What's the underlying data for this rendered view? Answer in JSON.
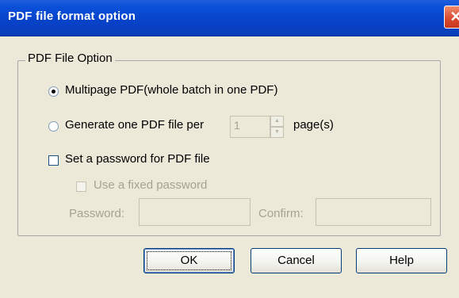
{
  "window": {
    "title": "PDF file format option",
    "close_glyph": "✕"
  },
  "group": {
    "legend": "PDF File Option"
  },
  "options": {
    "multipage_label": "Multipage PDF(whole batch in one PDF)",
    "multipage_selected": true,
    "per_page_label": "Generate one PDF file per",
    "per_page_selected": false,
    "pages_value": "1",
    "pages_suffix": "page(s)"
  },
  "password": {
    "set_label": "Set a password for PDF file",
    "set_checked": false,
    "fixed_label": "Use a fixed password",
    "fixed_checked": false,
    "password_label": "Password:",
    "password_value": "",
    "confirm_label": "Confirm:",
    "confirm_value": ""
  },
  "buttons": {
    "ok": "OK",
    "cancel": "Cancel",
    "help": "Help"
  }
}
